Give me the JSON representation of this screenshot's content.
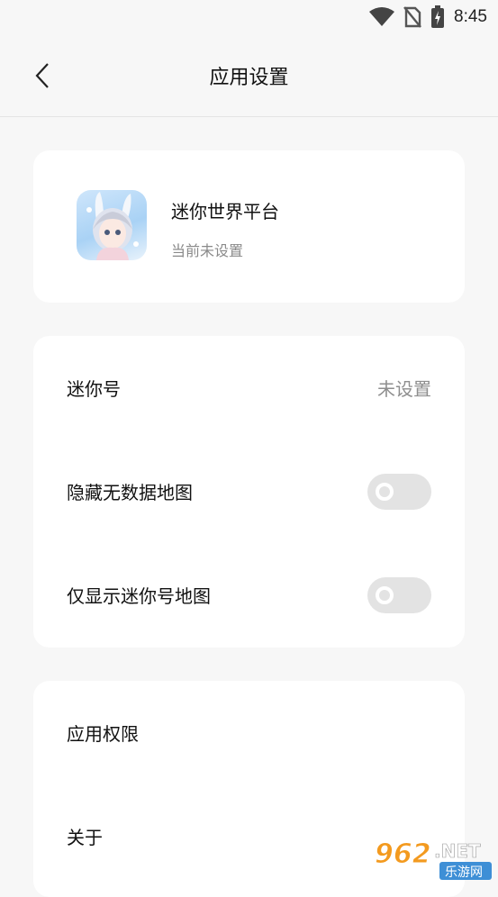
{
  "status_bar": {
    "time": "8:45"
  },
  "header": {
    "title": "应用设置"
  },
  "app_card": {
    "name": "迷你世界平台",
    "subtitle": "当前未设置"
  },
  "settings": {
    "mini_number": {
      "label": "迷你号",
      "value": "未设置"
    },
    "hide_no_data_maps": {
      "label": "隐藏无数据地图",
      "enabled": false
    },
    "show_mini_maps_only": {
      "label": "仅显示迷你号地图",
      "enabled": false
    }
  },
  "more": {
    "permissions": {
      "label": "应用权限"
    },
    "about": {
      "label": "关于"
    }
  },
  "watermark": {
    "text": "962.NET",
    "sub": "乐游网"
  }
}
